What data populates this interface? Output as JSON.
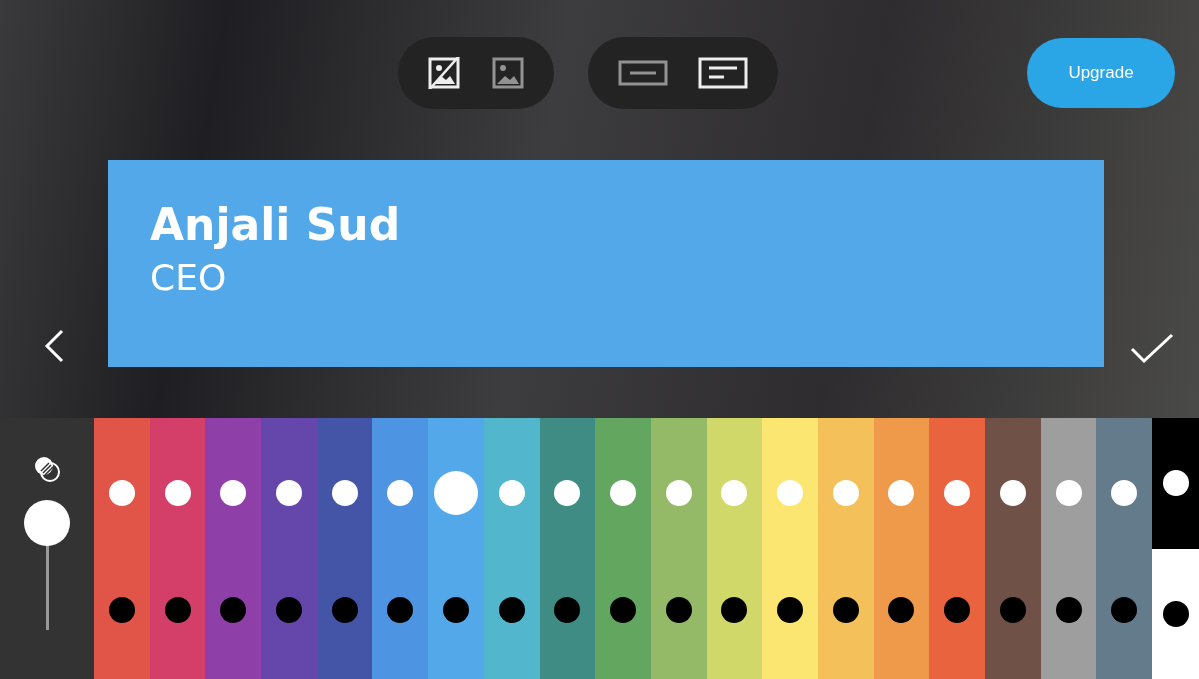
{
  "toolbar": {
    "image_modes": [
      {
        "kind": "no-image",
        "selected": true
      },
      {
        "kind": "image",
        "selected": false
      }
    ],
    "layouts": [
      {
        "kind": "centered",
        "selected": false
      },
      {
        "kind": "left",
        "selected": true
      }
    ]
  },
  "upgrade_button": "Upgrade",
  "card": {
    "name": "Anjali Sud",
    "title": "CEO",
    "color": "#52a8e8"
  },
  "opacity_slider": {
    "level": 1
  },
  "palette": [
    {
      "kind": "solid",
      "color": "#e05548",
      "selected": false
    },
    {
      "kind": "solid",
      "color": "#d33f68",
      "selected": false
    },
    {
      "kind": "solid",
      "color": "#8e3fa8",
      "selected": false
    },
    {
      "kind": "solid",
      "color": "#6546ab",
      "selected": false
    },
    {
      "kind": "solid",
      "color": "#4455a8",
      "selected": false
    },
    {
      "kind": "solid",
      "color": "#4d95e2",
      "selected": false
    },
    {
      "kind": "solid",
      "color": "#52a8e8",
      "selected": true
    },
    {
      "kind": "solid",
      "color": "#52b7cc",
      "selected": false
    },
    {
      "kind": "solid",
      "color": "#3f8c84",
      "selected": false
    },
    {
      "kind": "solid",
      "color": "#63a660",
      "selected": false
    },
    {
      "kind": "solid",
      "color": "#94ba68",
      "selected": false
    },
    {
      "kind": "solid",
      "color": "#d0d86a",
      "selected": false
    },
    {
      "kind": "solid",
      "color": "#fae671",
      "selected": false
    },
    {
      "kind": "solid",
      "color": "#f4c05a",
      "selected": false
    },
    {
      "kind": "solid",
      "color": "#ef9a4a",
      "selected": false
    },
    {
      "kind": "solid",
      "color": "#e9633f",
      "selected": false
    },
    {
      "kind": "solid",
      "color": "#6f5147",
      "selected": false
    },
    {
      "kind": "solid",
      "color": "#9e9e9e",
      "selected": false
    },
    {
      "kind": "solid",
      "color": "#637b8a",
      "selected": false
    },
    {
      "kind": "split",
      "color": "#000000",
      "selected": false
    }
  ]
}
